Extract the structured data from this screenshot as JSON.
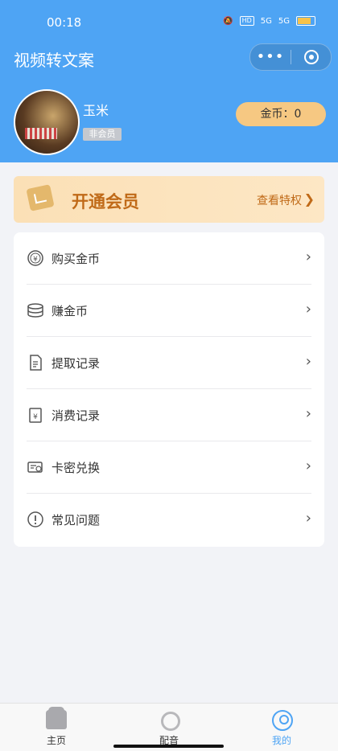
{
  "status_bar": {
    "time": "00:18",
    "signal1": "5G",
    "signal2": "5G",
    "hd": "HD"
  },
  "nav": {
    "title": "视频转文案",
    "more_label": "•••"
  },
  "profile": {
    "username": "玉米",
    "member_status": "非会员",
    "coins": "金币：0"
  },
  "vip": {
    "title": "开通会员",
    "link": "查看特权"
  },
  "menu": [
    {
      "label": "购买金币",
      "icon": "yen-coin-icon"
    },
    {
      "label": "赚金币",
      "icon": "coin-stack-icon"
    },
    {
      "label": "提取记录",
      "icon": "document-icon"
    },
    {
      "label": "消费记录",
      "icon": "receipt-icon"
    },
    {
      "label": "卡密兑换",
      "icon": "card-key-icon"
    },
    {
      "label": "常见问题",
      "icon": "exclamation-circle-icon"
    }
  ],
  "tabs": [
    {
      "label": "主页",
      "icon": "home-icon"
    },
    {
      "label": "配音",
      "icon": "dubbing-icon"
    },
    {
      "label": "我的",
      "icon": "user-icon"
    }
  ],
  "colors": {
    "primary": "#4ea4f4",
    "vip_text": "#c06a18",
    "coin_pill": "#f6c882"
  }
}
